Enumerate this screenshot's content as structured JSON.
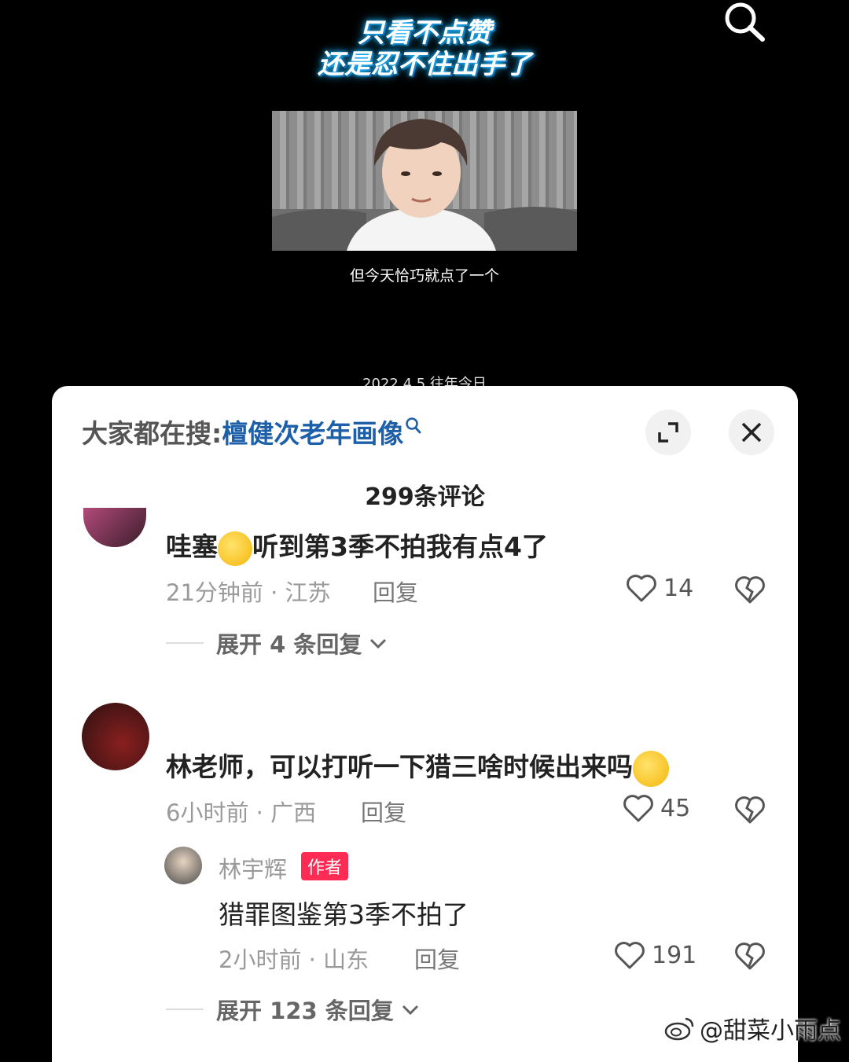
{
  "video": {
    "headline_line1": "只看不点赞",
    "headline_line2": "还是忍不住出手了",
    "subtitle": "但今天恰巧就点了一个",
    "date_line": "2022.4.5 往年今日"
  },
  "sheet": {
    "search_hint_prefix": "大家都在搜:",
    "search_hint_keyword": "檀健次老年画像",
    "comment_count": "299条评论"
  },
  "comments": [
    {
      "text_before": "哇塞",
      "text_after": "听到第3季不拍我有点4了",
      "meta": "21分钟前 · 江苏",
      "reply": "回复",
      "likes": "14",
      "expand": "展开 4 条回复"
    },
    {
      "text": "林老师，可以打听一下猎三啥时候出来吗",
      "meta": "6小时前 · 广西",
      "reply": "回复",
      "likes": "45"
    }
  ],
  "author_reply": {
    "name": "林宇辉",
    "badge": "作者",
    "text": "猎罪图鉴第3季不拍了",
    "meta": "2小时前 · 山东",
    "reply": "回复",
    "likes": "191",
    "expand": "展开 123 条回复"
  },
  "watermark": "@甜菜小雨点",
  "colors": {
    "keyword_link": "#1d5fa8",
    "author_badge": "#fe2c55"
  }
}
